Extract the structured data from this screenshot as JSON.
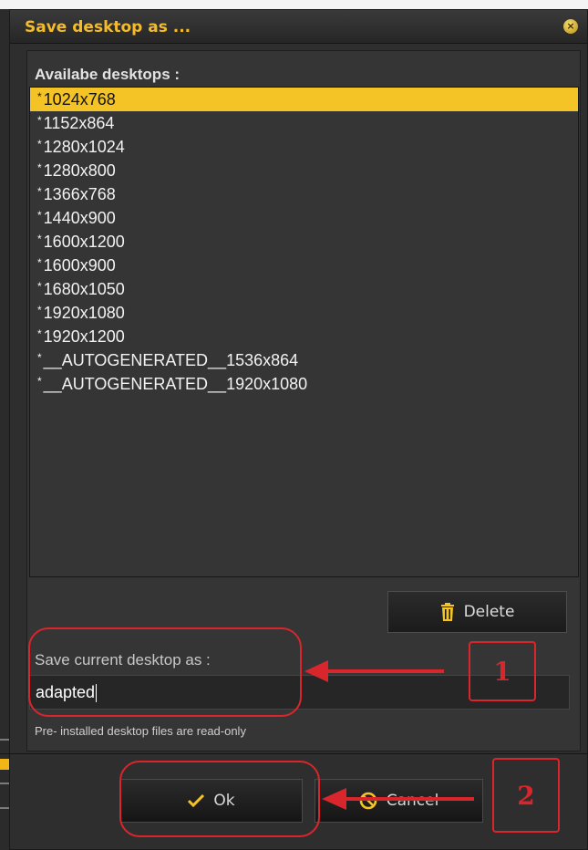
{
  "dialog": {
    "title": "Save desktop as ...",
    "close_icon": "close-icon"
  },
  "list": {
    "label": "Availabe desktops :",
    "items": [
      {
        "marker": "*",
        "label": "1024x768",
        "selected": true
      },
      {
        "marker": "*",
        "label": "1152x864"
      },
      {
        "marker": "*",
        "label": "1280x1024"
      },
      {
        "marker": "*",
        "label": "1280x800"
      },
      {
        "marker": "*",
        "label": "1366x768"
      },
      {
        "marker": "*",
        "label": "1440x900"
      },
      {
        "marker": "*",
        "label": "1600x1200"
      },
      {
        "marker": "*",
        "label": "1600x900"
      },
      {
        "marker": "*",
        "label": "1680x1050"
      },
      {
        "marker": "*",
        "label": "1920x1080"
      },
      {
        "marker": "*",
        "label": "1920x1200"
      },
      {
        "marker": "*",
        "label": "__AUTOGENERATED__1536x864"
      },
      {
        "marker": "*",
        "label": "__AUTOGENERATED__1920x1080"
      }
    ]
  },
  "delete_button": {
    "label": "Delete",
    "icon": "trash-icon"
  },
  "save": {
    "label": "Save current desktop as :",
    "value": "adapted",
    "hint": "Pre- installed desktop files are read-only"
  },
  "footer": {
    "ok_label": "Ok",
    "ok_icon": "checkmark-icon",
    "cancel_label": "Cancel",
    "cancel_icon": "cancel-icon"
  },
  "annotations": [
    {
      "number": "1"
    },
    {
      "number": "2"
    }
  ],
  "colors": {
    "accent": "#f4c325",
    "title": "#f4bc2a",
    "annotation": "#d9262c",
    "background": "#2e2e2e"
  }
}
